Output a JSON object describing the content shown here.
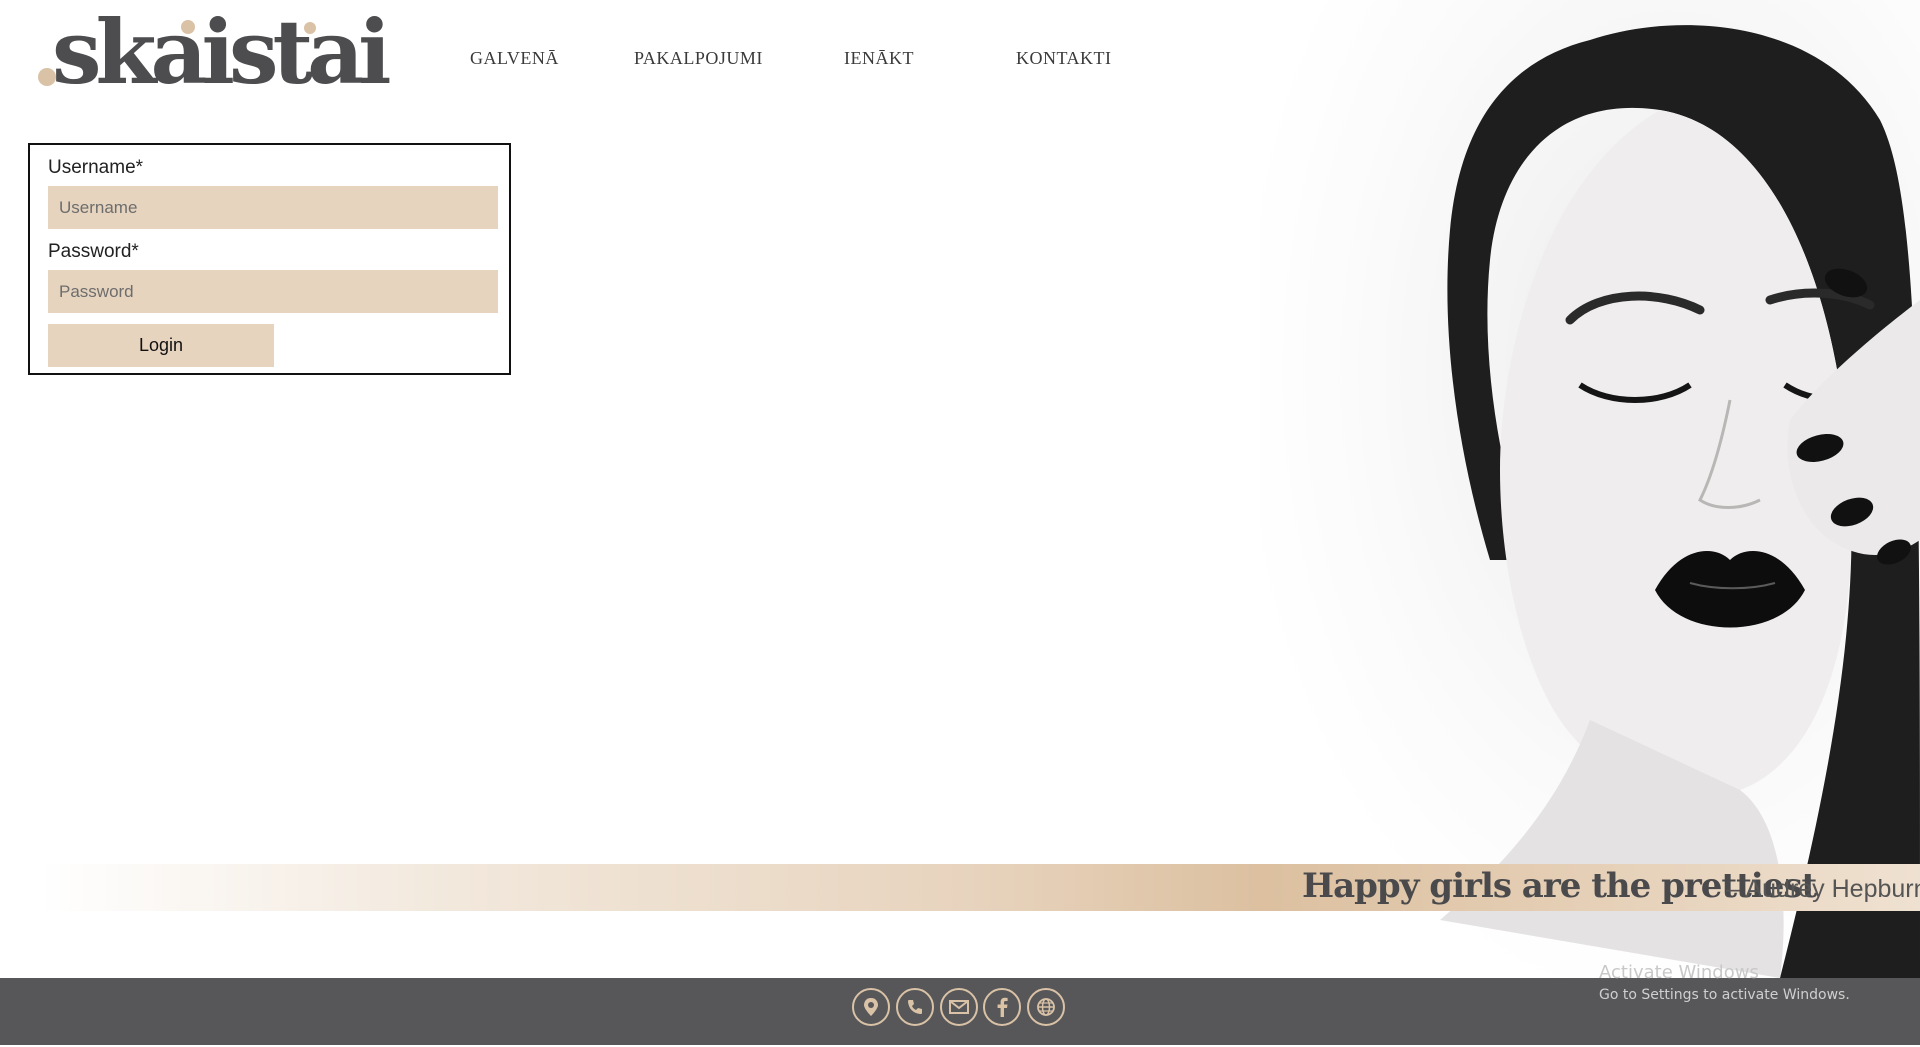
{
  "brand": {
    "logo_text": "skaistai",
    "accent_color": "#d9c2a6",
    "text_color": "#4d4d4f"
  },
  "nav": {
    "items": [
      {
        "label": "GALVENĀ"
      },
      {
        "label": "PAKALPOJUMI"
      },
      {
        "label": "IENĀKT"
      },
      {
        "label": "KONTAKTI"
      }
    ]
  },
  "login": {
    "username_label": "Username*",
    "username_placeholder": "Username",
    "username_value": "",
    "password_label": "Password*",
    "password_placeholder": "Password",
    "password_value": "",
    "button_label": "Login",
    "field_color": "#e6d4bf"
  },
  "quote": {
    "text": "Happy girls are the prettiest",
    "author": "– Audrey Hepburn"
  },
  "footer": {
    "background": "#575759",
    "icons": [
      "location-icon",
      "phone-icon",
      "mail-icon",
      "facebook-icon",
      "globe-icon"
    ]
  },
  "watermark": {
    "title": "Activate Windows",
    "subtitle": "Go to Settings to activate Windows."
  }
}
